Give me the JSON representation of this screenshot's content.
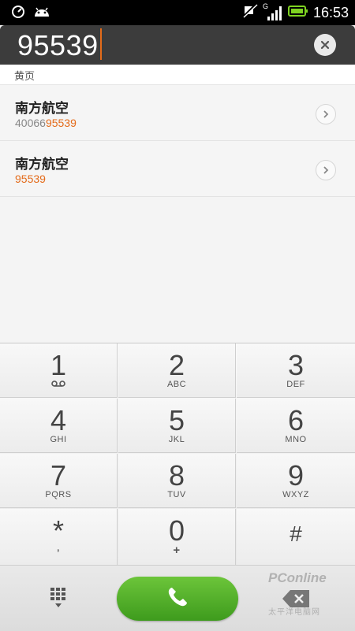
{
  "status_bar": {
    "time": "16:53",
    "network_label": "G",
    "icons": [
      "clock-icon",
      "android-icon",
      "mute-icon",
      "signal-icon",
      "battery-icon"
    ],
    "accent": "#7ed321"
  },
  "dialer": {
    "number": "95539",
    "clear_icon": "close-icon"
  },
  "section": {
    "title": "黄页"
  },
  "results": [
    {
      "name": "南方航空",
      "number_prefix": "40066",
      "number_match": "95539"
    },
    {
      "name": "南方航空",
      "number_prefix": "",
      "number_match": "95539"
    }
  ],
  "keys": [
    {
      "digit": "1",
      "letters": ""
    },
    {
      "digit": "2",
      "letters": "ABC"
    },
    {
      "digit": "3",
      "letters": "DEF"
    },
    {
      "digit": "4",
      "letters": "GHI"
    },
    {
      "digit": "5",
      "letters": "JKL"
    },
    {
      "digit": "6",
      "letters": "MNO"
    },
    {
      "digit": "7",
      "letters": "PQRS"
    },
    {
      "digit": "8",
      "letters": "TUV"
    },
    {
      "digit": "9",
      "letters": "WXYZ"
    },
    {
      "digit": "*",
      "letters": ","
    },
    {
      "digit": "0",
      "letters": "+"
    },
    {
      "digit": "#",
      "letters": ""
    }
  ],
  "bottom_bar": {
    "call_color": "#4fae27",
    "watermark": "PConline",
    "watermark_sub": "太平洋电脑网"
  },
  "colors": {
    "highlight": "#e46b1a",
    "header": "#3c3c3c"
  }
}
